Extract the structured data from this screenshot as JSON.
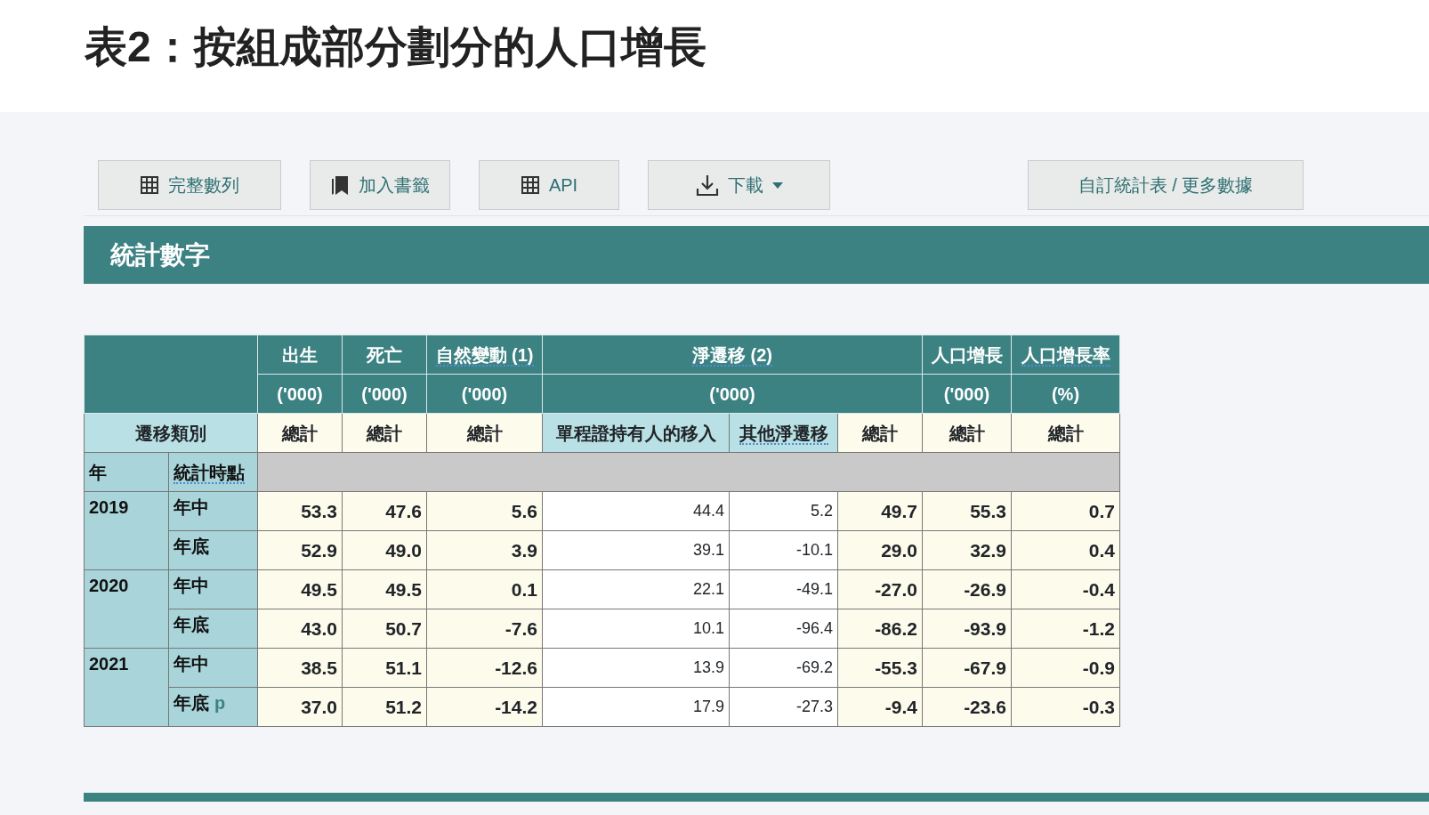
{
  "title": "表2：按組成部分劃分的人口增長",
  "buttons": [
    {
      "label": "完整數列",
      "kind": "grid"
    },
    {
      "label": "加入書籤",
      "kind": "bookmark"
    },
    {
      "label": "API",
      "kind": "grid"
    },
    {
      "label": "下載",
      "kind": "download",
      "dropdown": true
    },
    {
      "label": "自訂統計表 / 更多數據",
      "kind": "none"
    }
  ],
  "section_title": "統計數字",
  "table": {
    "row_header_label": "遷移類別",
    "year_label": "年",
    "point_label": "統計時點",
    "point_label_abbr": true,
    "columns": [
      {
        "label": "出生",
        "unit": "('000)",
        "subs": [
          {
            "label": "總計",
            "kind": "total"
          }
        ]
      },
      {
        "label": "死亡",
        "unit": "('000)",
        "subs": [
          {
            "label": "總計",
            "kind": "total"
          }
        ]
      },
      {
        "label": "自然變動 (1)",
        "abbr": true,
        "unit": "('000)",
        "subs": [
          {
            "label": "總計",
            "kind": "total"
          }
        ]
      },
      {
        "label": "淨遷移 (2)",
        "abbr": true,
        "unit": "('000)",
        "subs": [
          {
            "label": "單程證持有人的移入",
            "kind": "component"
          },
          {
            "label": "其他淨遷移",
            "kind": "component",
            "abbr": true
          },
          {
            "label": "總計",
            "kind": "total"
          }
        ]
      },
      {
        "label": "人口增長",
        "unit": "('000)",
        "subs": [
          {
            "label": "總計",
            "kind": "total"
          }
        ]
      },
      {
        "label": "人口增長率",
        "abbr": true,
        "unit": "(%)",
        "subs": [
          {
            "label": "總計",
            "kind": "total"
          }
        ]
      }
    ],
    "rows": [
      {
        "year": "2019",
        "points": [
          {
            "label": "年中",
            "values": [
              "53.3",
              "47.6",
              "5.6",
              "44.4",
              "5.2",
              "49.7",
              "55.3",
              "0.7"
            ]
          },
          {
            "label": "年底",
            "values": [
              "52.9",
              "49.0",
              "3.9",
              "39.1",
              "-10.1",
              "29.0",
              "32.9",
              "0.4"
            ]
          }
        ]
      },
      {
        "year": "2020",
        "points": [
          {
            "label": "年中",
            "values": [
              "49.5",
              "49.5",
              "0.1",
              "22.1",
              "-49.1",
              "-27.0",
              "-26.9",
              "-0.4"
            ]
          },
          {
            "label": "年底",
            "values": [
              "43.0",
              "50.7",
              "-7.6",
              "10.1",
              "-96.4",
              "-86.2",
              "-93.9",
              "-1.2"
            ]
          }
        ]
      },
      {
        "year": "2021",
        "points": [
          {
            "label": "年中",
            "values": [
              "38.5",
              "51.1",
              "-12.6",
              "13.9",
              "-69.2",
              "-55.3",
              "-67.9",
              "-0.9"
            ]
          },
          {
            "label": "年底",
            "flag": "p",
            "values": [
              "37.0",
              "51.2",
              "-14.2",
              "17.9",
              "-27.3",
              "-9.4",
              "-23.6",
              "-0.3"
            ]
          }
        ]
      }
    ]
  }
}
